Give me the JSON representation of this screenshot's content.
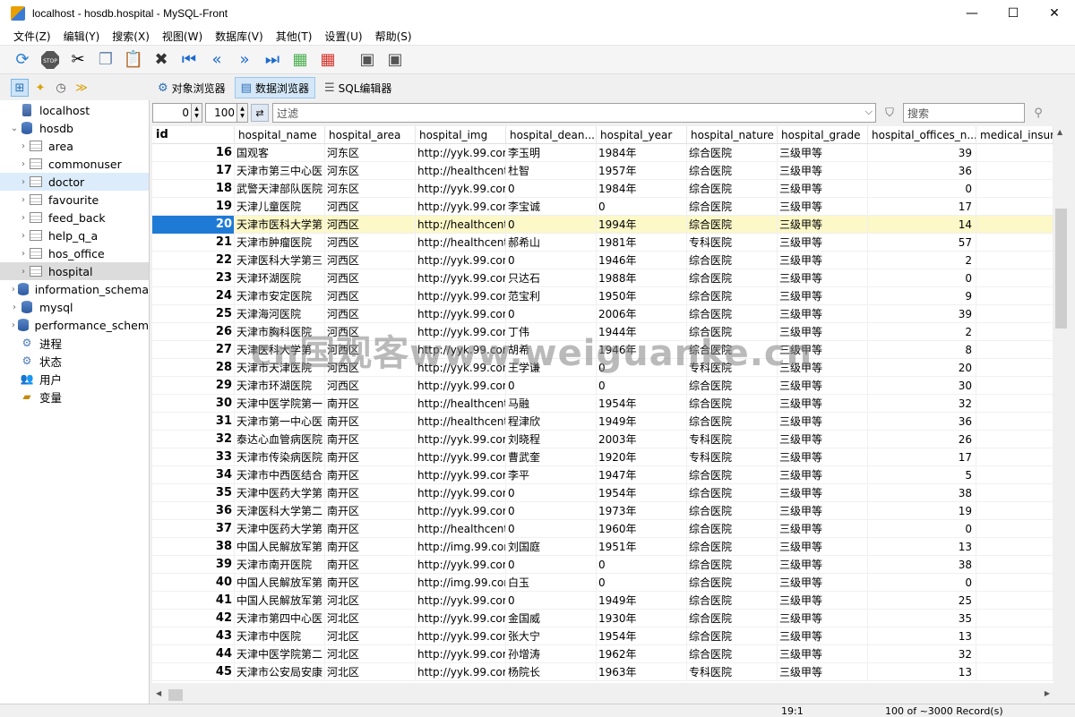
{
  "window": {
    "title": "localhost - hosdb.hospital - MySQL-Front"
  },
  "menu": [
    "文件(Z)",
    "编辑(Y)",
    "搜索(X)",
    "视图(W)",
    "数据库(V)",
    "其他(T)",
    "设置(U)",
    "帮助(S)"
  ],
  "tabs": {
    "object_browser": "对象浏览器",
    "data_browser": "数据浏览器",
    "sql_editor": "SQL编辑器"
  },
  "filter": {
    "offset": "0",
    "limit": "100",
    "placeholder": "过滤",
    "search_placeholder": "搜索"
  },
  "tree": [
    {
      "label": "localhost",
      "level": 0,
      "icon": "server-icon"
    },
    {
      "label": "hosdb",
      "level": 1,
      "icon": "database-icon",
      "expanded": true
    },
    {
      "label": "area",
      "level": 2,
      "icon": "table-icon"
    },
    {
      "label": "commonuser",
      "level": 2,
      "icon": "table-icon"
    },
    {
      "label": "doctor",
      "level": 2,
      "icon": "table-icon",
      "state": "hover"
    },
    {
      "label": "favourite",
      "level": 2,
      "icon": "table-icon"
    },
    {
      "label": "feed_back",
      "level": 2,
      "icon": "table-icon"
    },
    {
      "label": "help_q_a",
      "level": 2,
      "icon": "table-icon"
    },
    {
      "label": "hos_office",
      "level": 2,
      "icon": "table-icon"
    },
    {
      "label": "hospital",
      "level": 2,
      "icon": "table-icon",
      "state": "selected"
    },
    {
      "label": "information_schema",
      "level": 1,
      "icon": "database-icon"
    },
    {
      "label": "mysql",
      "level": 1,
      "icon": "database-icon"
    },
    {
      "label": "performance_schem",
      "level": 1,
      "icon": "database-icon"
    },
    {
      "label": "进程",
      "level": 0,
      "icon": "process-icon"
    },
    {
      "label": "状态",
      "level": 0,
      "icon": "status-icon"
    },
    {
      "label": "用户",
      "level": 0,
      "icon": "users-icon"
    },
    {
      "label": "变量",
      "level": 0,
      "icon": "variables-icon"
    }
  ],
  "columns": [
    "id",
    "hospital_name",
    "hospital_area",
    "hospital_img",
    "hospital_dean...",
    "hospital_year",
    "hospital_nature",
    "hospital_grade",
    "hospital_offices_n...",
    "medical_insur"
  ],
  "rows": [
    [
      "16",
      "国观客",
      "河东区",
      "http://yyk.99.com.c",
      "李玉明",
      "1984年",
      "综合医院",
      "三级甲等",
      "39"
    ],
    [
      "17",
      "天津市第三中心医",
      "河东区",
      "http://healthcenter",
      "杜智",
      "1957年",
      "综合医院",
      "三级甲等",
      "36"
    ],
    [
      "18",
      "武警天津部队医院",
      "河东区",
      "http://yyk.99.com.c",
      "0",
      "1984年",
      "综合医院",
      "三级甲等",
      "0"
    ],
    [
      "19",
      "天津儿童医院",
      "河西区",
      "http://yyk.99.com.c",
      "李宝诚",
      "0",
      "综合医院",
      "三级甲等",
      "17"
    ],
    [
      "20",
      "天津市医科大学第",
      "河西区",
      "http://healthcenter",
      "0",
      "1994年",
      "综合医院",
      "三级甲等",
      "14"
    ],
    [
      "21",
      "天津市肿瘤医院",
      "河西区",
      "http://healthcenter",
      "郝希山",
      "1981年",
      "专科医院",
      "三级甲等",
      "57"
    ],
    [
      "22",
      "天津医科大学第三",
      "河西区",
      "http://yyk.99.com.c",
      "0",
      "1946年",
      "综合医院",
      "三级甲等",
      "2"
    ],
    [
      "23",
      "天津环湖医院",
      "河西区",
      "http://yyk.99.com.c",
      "只达石",
      "1988年",
      "综合医院",
      "三级甲等",
      "0"
    ],
    [
      "24",
      "天津市安定医院",
      "河西区",
      "http://yyk.99.com.c",
      "范宝利",
      "1950年",
      "综合医院",
      "三级甲等",
      "9"
    ],
    [
      "25",
      "天津海河医院",
      "河西区",
      "http://yyk.99.com.c",
      "0",
      "2006年",
      "综合医院",
      "三级甲等",
      "39"
    ],
    [
      "26",
      "天津市胸科医院",
      "河西区",
      "http://yyk.99.com.c",
      "丁伟",
      "1944年",
      "综合医院",
      "三级甲等",
      "2"
    ],
    [
      "27",
      "天津医科大学第",
      "河西区",
      "http://yyk.99.com.c",
      "胡希",
      "1946年",
      "综合医院",
      "三级甲等",
      "8"
    ],
    [
      "28",
      "天津市天津医院",
      "河西区",
      "http://yyk.99.com.c",
      "王学谦",
      "0",
      "专科医院",
      "三级甲等",
      "20"
    ],
    [
      "29",
      "天津市环湖医院",
      "河西区",
      "http://yyk.99.com.c",
      "0",
      "0",
      "综合医院",
      "三级甲等",
      "30"
    ],
    [
      "30",
      "天津中医学院第一",
      "南开区",
      "http://healthcenter",
      "马融",
      "1954年",
      "综合医院",
      "三级甲等",
      "32"
    ],
    [
      "31",
      "天津市第一中心医",
      "南开区",
      "http://healthcenter",
      "程津欣",
      "1949年",
      "综合医院",
      "三级甲等",
      "36"
    ],
    [
      "32",
      "泰达心血管病医院",
      "南开区",
      "http://yyk.99.com.c",
      "刘晓程",
      "2003年",
      "专科医院",
      "三级甲等",
      "26"
    ],
    [
      "33",
      "天津市传染病医院",
      "南开区",
      "http://yyk.99.com.c",
      "曹武奎",
      "1920年",
      "专科医院",
      "三级甲等",
      "17"
    ],
    [
      "34",
      "天津市中西医结合",
      "南开区",
      "http://yyk.99.com.c",
      "李平",
      "1947年",
      "综合医院",
      "三级甲等",
      "5"
    ],
    [
      "35",
      "天津中医药大学第",
      "南开区",
      "http://yyk.99.com.c",
      "0",
      "1954年",
      "综合医院",
      "三级甲等",
      "38"
    ],
    [
      "36",
      "天津医科大学第二",
      "南开区",
      "http://yyk.99.com.c",
      "0",
      "1973年",
      "综合医院",
      "三级甲等",
      "19"
    ],
    [
      "37",
      "天津中医药大学第",
      "南开区",
      "http://healthcenter",
      "0",
      "1960年",
      "综合医院",
      "三级甲等",
      "0"
    ],
    [
      "38",
      "中国人民解放军第",
      "南开区",
      "http://img.99.com.",
      "刘国庭",
      "1951年",
      "综合医院",
      "三级甲等",
      "13"
    ],
    [
      "39",
      "天津市南开医院",
      "南开区",
      "http://yyk.99.com.c",
      "0",
      "0",
      "综合医院",
      "三级甲等",
      "38"
    ],
    [
      "40",
      "中国人民解放军第",
      "南开区",
      "http://img.99.com.",
      "白玉",
      "0",
      "综合医院",
      "三级甲等",
      "0"
    ],
    [
      "41",
      "中国人民解放军第",
      "河北区",
      "http://yyk.99.com.c",
      "0",
      "1949年",
      "综合医院",
      "三级甲等",
      "25"
    ],
    [
      "42",
      "天津市第四中心医",
      "河北区",
      "http://yyk.99.com.c",
      "金国威",
      "1930年",
      "综合医院",
      "三级甲等",
      "35"
    ],
    [
      "43",
      "天津市中医院",
      "河北区",
      "http://yyk.99.com.c",
      "张大宁",
      "1954年",
      "综合医院",
      "三级甲等",
      "13"
    ],
    [
      "44",
      "天津中医学院第二",
      "河北区",
      "http://yyk.99.com.c",
      "孙增涛",
      "1962年",
      "综合医院",
      "三级甲等",
      "32"
    ],
    [
      "45",
      "天津市公安局安康",
      "河北区",
      "http://yyk.99.com.c",
      "杨院长",
      "1963年",
      "专科医院",
      "三级甲等",
      "13"
    ]
  ],
  "selected_row_id": "20",
  "status": {
    "position": "19:1",
    "records": "100 of ~3000 Record(s)"
  },
  "watermark": "cn国观客www.weiguanke.cn",
  "colors": {
    "selection": "#1f7ad6",
    "highlight_row": "#fcf8c8",
    "tree_selected": "#dcdcdc"
  }
}
